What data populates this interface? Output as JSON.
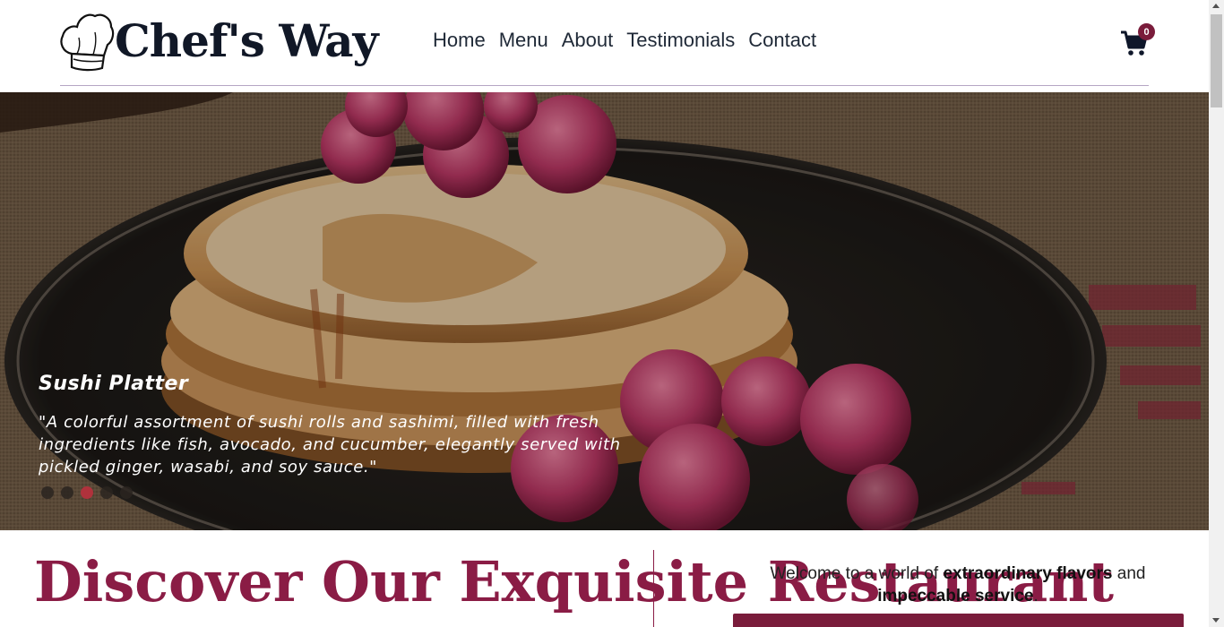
{
  "brand": {
    "name": "Chef's Way",
    "logo_icon": "chef-hat-icon"
  },
  "nav": {
    "items": [
      {
        "label": "Home"
      },
      {
        "label": "Menu"
      },
      {
        "label": "About"
      },
      {
        "label": "Testimonials"
      },
      {
        "label": "Contact"
      }
    ]
  },
  "cart": {
    "icon": "shopping-cart-icon",
    "count": "0"
  },
  "hero": {
    "caption_title": "Sushi Platter",
    "caption_text": "\"A colorful assortment of sushi rolls and sashimi, filled with fresh ingredients like fish, avocado, and cucumber, elegantly served with pickled ginger, wasabi, and soy sauce.\"",
    "slide_count": 5,
    "active_slide": 3
  },
  "section": {
    "heading": "Discover Our Exquisite Restaurant",
    "welcome_prefix": "Welcome to a world of ",
    "welcome_bold_1": "extraordinary flavors",
    "welcome_mid": " and ",
    "welcome_bold_2": "impeccable service",
    "welcome_suffix": "."
  },
  "colors": {
    "accent": "#7a1c3b",
    "heading": "#8a1c45",
    "active_dot": "#b0323c"
  }
}
